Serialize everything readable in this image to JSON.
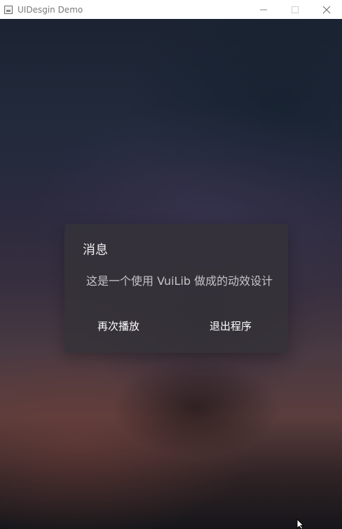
{
  "window": {
    "title": "UIDesgin Demo",
    "controls": {
      "minimize_icon": "minimize-icon",
      "maximize_icon": "maximize-icon",
      "close_icon": "close-icon"
    }
  },
  "dialog": {
    "title": "消息",
    "message": "这是一个使用 VuiLib 做成的动效设计",
    "buttons": {
      "replay_label": "再次播放",
      "exit_label": "退出程序"
    }
  },
  "colors": {
    "titlebar_bg": "#ffffff",
    "dialog_bg": "#343238",
    "dialog_title": "#eeeeee",
    "dialog_text": "#c7c4c8",
    "button_text": "#ffffff"
  }
}
